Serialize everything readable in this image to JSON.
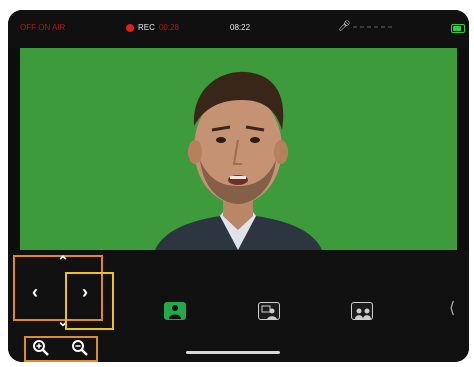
{
  "status": {
    "on_air": "OFF ON AIR",
    "rec_label": "REC",
    "rec_time": "00:28",
    "clock": "08:22",
    "mic_icon": "microphone-icon",
    "battery_icon": "battery-icon"
  },
  "controls": {
    "pan_up_icon": "chevron-up-icon",
    "pan_down_icon": "chevron-down-icon",
    "pan_left_icon": "chevron-left-icon",
    "pan_right_icon": "chevron-right-icon",
    "zoom_in_icon": "zoom-in-icon",
    "zoom_out_icon": "zoom-out-icon",
    "modes": [
      "single-person-icon",
      "picture-in-picture-icon",
      "side-by-side-icon"
    ],
    "active_mode": "single-person-icon",
    "more_icon": "chevron-left-icon"
  },
  "colors": {
    "on_air_red": "#b01717",
    "rec_dot": "#e0221a",
    "battery": "#2ecc40",
    "chroma_green": "#3d9b3b",
    "pad_highlight": "#e08a2a",
    "right_highlight": "#f2c01c",
    "active_mode": "#23a84a"
  }
}
